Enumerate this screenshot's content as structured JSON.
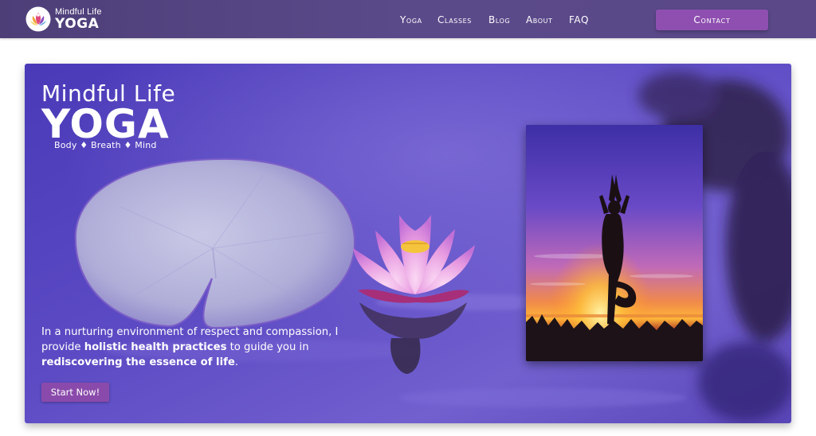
{
  "brand": {
    "line1": "Mindful Life",
    "line2": "YOGA"
  },
  "nav": {
    "items": [
      "Yoga",
      "Classes",
      "Blog",
      "About",
      "FAQ"
    ],
    "contact_label": "Contact"
  },
  "hero": {
    "title_line1": "Mindful Life",
    "title_line2": "YOGA",
    "tagline": "Body ♦ Breath ♦ Mind",
    "text_part1": "In a nurturing environment of respect and compassion, I provide ",
    "text_bold1": "holistic health practices",
    "text_part2": " to guide you in ",
    "text_bold2": "rediscovering the essence of life",
    "text_part3": ".",
    "cta_label": "Start Now!"
  },
  "colors": {
    "navbar": "#5b4a8a",
    "button": "#8e4fb0",
    "hero_water": "#6a55c4",
    "lotus": "#e58fd8"
  },
  "icons": {
    "logo": "lotus-person-logo-icon"
  }
}
